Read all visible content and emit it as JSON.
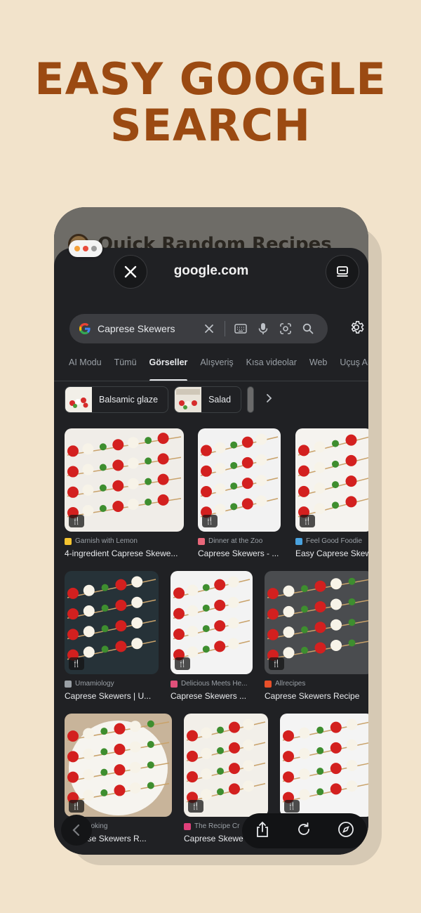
{
  "headline": [
    "EASY GOOGLE",
    "SEARCH"
  ],
  "background_app": {
    "title": "Quick Random Recipes"
  },
  "window_dots": [
    "#f4a13a",
    "#e84b3c",
    "#9b9b9b"
  ],
  "browser": {
    "url": "google.com",
    "close_icon": "close-icon",
    "tabs_icon": "tabs-icon"
  },
  "search": {
    "query": "Caprese Skewers",
    "icons": [
      "google-logo",
      "clear-icon",
      "keyboard-icon",
      "mic-icon",
      "lens-icon",
      "search-icon"
    ],
    "settings_icon": "gear-icon"
  },
  "tabs": [
    {
      "label": "AI Modu",
      "active": false
    },
    {
      "label": "Tümü",
      "active": false
    },
    {
      "label": "Görseller",
      "active": true
    },
    {
      "label": "Alışveriş",
      "active": false
    },
    {
      "label": "Kısa videolar",
      "active": false
    },
    {
      "label": "Web",
      "active": false
    },
    {
      "label": "Uçuş Ara",
      "active": false
    }
  ],
  "chips": [
    {
      "label": "Balsamic glaze"
    },
    {
      "label": "Salad"
    }
  ],
  "results": [
    {
      "source": "Garnish with Lemon",
      "title": "4-ingredient Caprese Skewe...",
      "source_color": "#f4c430"
    },
    {
      "source": "Dinner at the Zoo",
      "title": "Caprese Skewers - ...",
      "source_color": "#e8677a"
    },
    {
      "source": "Feel Good Foodie",
      "title": "Easy Caprese Skew",
      "source_color": "#4aa3df"
    },
    {
      "source": "Umamiology",
      "title": "Caprese Skewers | U...",
      "source_color": "#9aa0a6"
    },
    {
      "source": "Delicious Meets He...",
      "title": "Caprese Skewers ...",
      "source_color": "#e0507a"
    },
    {
      "source": "Allrecipes",
      "title": "Caprese Skewers Recipe",
      "source_color": "#e8502a"
    },
    {
      "source": "'s Cooking",
      "title": "Caprese Skewers R...",
      "source_color": "#c9a24a"
    },
    {
      "source": "The Recipe Cr",
      "title": "Caprese Skewe",
      "source_color": "#e0407a"
    },
    {
      "source": "",
      "title": "",
      "source_color": "#c0392b"
    }
  ],
  "badge_glyph": "🍴",
  "bottom_bar": {
    "icons": [
      "back-icon",
      "share-icon",
      "reload-icon",
      "compass-icon"
    ]
  }
}
